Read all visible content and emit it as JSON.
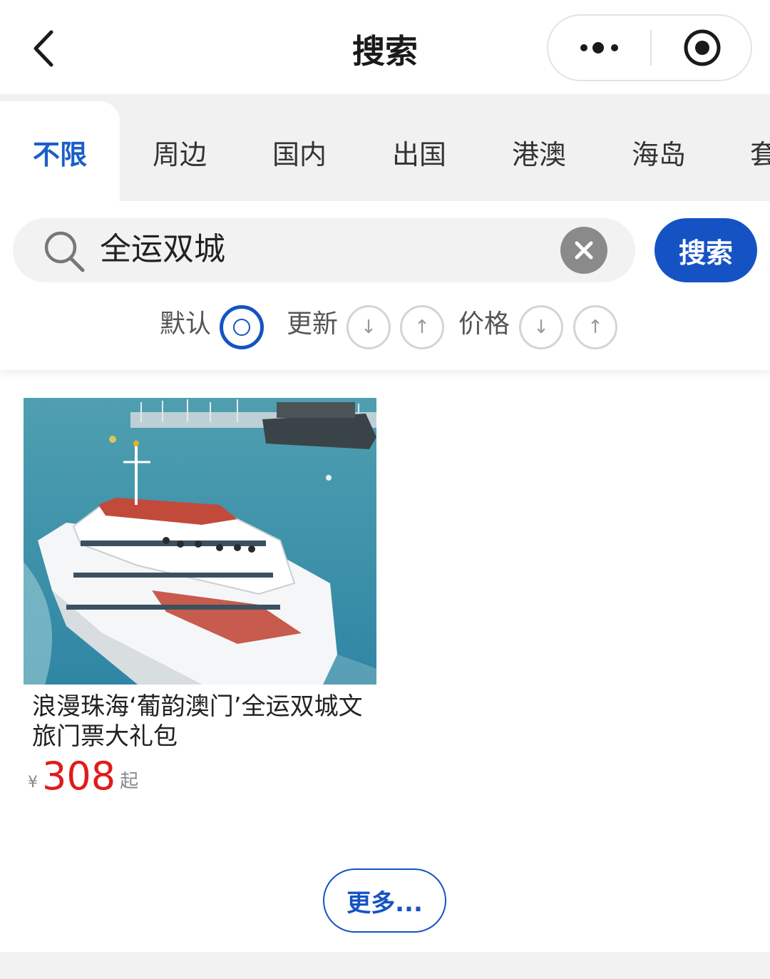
{
  "header": {
    "title": "搜索"
  },
  "categories": [
    "不限",
    "周边",
    "国内",
    "出国",
    "港澳",
    "海岛",
    "套"
  ],
  "search": {
    "value": "全运双城",
    "button_label": "搜索"
  },
  "sort": {
    "default_label": "默认",
    "updated_label": "更新",
    "price_label": "价格",
    "down_arrow": "↓",
    "up_arrow": "↑"
  },
  "products": [
    {
      "title": "浪漫珠海‘葡韵澳门’全运双城文旅门票大礼包",
      "currency": "¥",
      "price": "308",
      "price_suffix": "起"
    }
  ],
  "more_label": "更多...",
  "colors": {
    "accent": "#1553c4",
    "price": "#e01b1b",
    "tab_active": "#1a5fc9"
  }
}
